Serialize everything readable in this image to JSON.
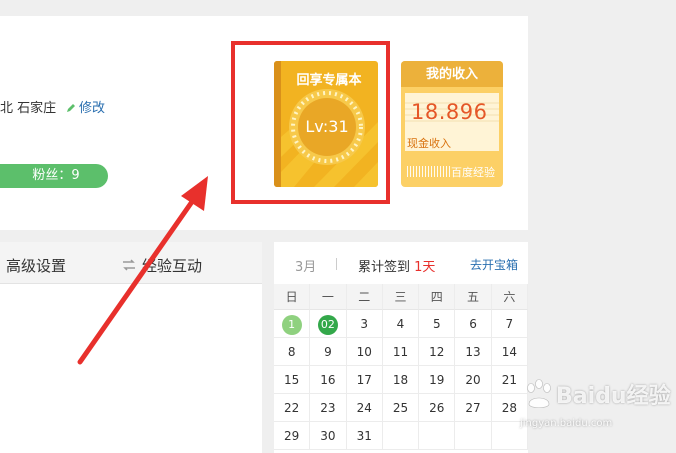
{
  "profile": {
    "location": "北 石家庄",
    "edit_label": "修改",
    "fans_label": "粉丝：9"
  },
  "level_book": {
    "title": "回享专属本",
    "level": "Lv:31"
  },
  "income": {
    "title": "我的收入",
    "value": "18.896",
    "label": "现金收入",
    "footer": "百度经验"
  },
  "tabs": {
    "advanced": "高级设置",
    "interact": "经验互动"
  },
  "calendar": {
    "month": "3月",
    "signin_prefix": "累计签到",
    "signin_days": "1天",
    "treasure_link": "去开宝箱",
    "weekdays": [
      "日",
      "一",
      "二",
      "三",
      "四",
      "五",
      "六"
    ],
    "weeks": [
      [
        "1",
        "02",
        "3",
        "4",
        "5",
        "6",
        "7"
      ],
      [
        "8",
        "9",
        "10",
        "11",
        "12",
        "13",
        "14"
      ],
      [
        "15",
        "16",
        "17",
        "18",
        "19",
        "20",
        "21"
      ],
      [
        "22",
        "23",
        "24",
        "25",
        "26",
        "27",
        "28"
      ],
      [
        "29",
        "30",
        "31",
        "",
        "",
        "",
        ""
      ]
    ]
  },
  "watermark": {
    "brand": "Baidu经验",
    "url": "jingyan.baidu.com"
  },
  "colors": {
    "highlight": "#e8302c",
    "fans_badge": "#5cbf6b",
    "book": "#f2b321",
    "income_value": "#e55728",
    "link": "#2a6fb0"
  }
}
